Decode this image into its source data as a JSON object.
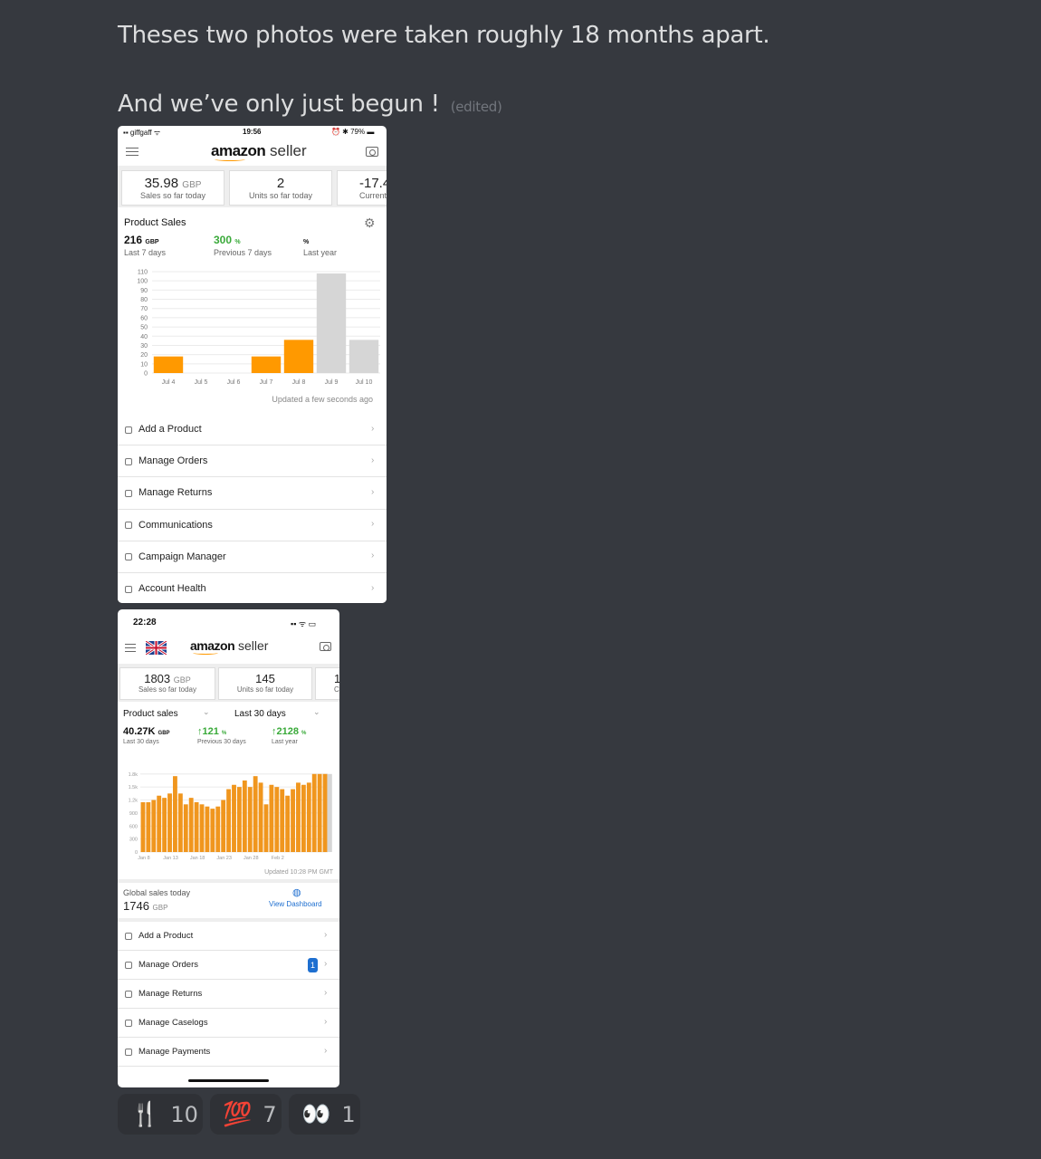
{
  "message": {
    "line1": "Theses two photos were taken roughly 18 months apart.",
    "line2": "And we’ve only just begun !",
    "edited": "(edited)"
  },
  "photo1": {
    "status": {
      "carrier": "giffgaff",
      "time": "19:56",
      "battery": "79%"
    },
    "logo": {
      "brand": "amazon",
      "product": "seller"
    },
    "stats": [
      {
        "value": "35.98",
        "unit": "GBP",
        "label": "Sales so far today"
      },
      {
        "value": "2",
        "unit": "",
        "label": "Units so far today"
      },
      {
        "value": "-17.4",
        "unit": "",
        "label": "Current"
      }
    ],
    "section_title": "Product Sales",
    "metrics": [
      {
        "value": "216",
        "unit": "GBP",
        "label": "Last 7 days"
      },
      {
        "value": "300",
        "unit": "%",
        "label": "Previous 7 days"
      },
      {
        "value": "",
        "unit": "%",
        "label": "Last year"
      }
    ],
    "updated": "Updated a few seconds ago",
    "menu": [
      {
        "label": "Add a Product",
        "icon": "tag-icon"
      },
      {
        "label": "Manage Orders",
        "icon": "box-icon"
      },
      {
        "label": "Manage Returns",
        "icon": "return-bag-icon"
      },
      {
        "label": "Communications",
        "icon": "chat-icon"
      },
      {
        "label": "Campaign Manager",
        "icon": "campaign-icon"
      },
      {
        "label": "Account Health",
        "icon": "trend-icon"
      }
    ]
  },
  "photo2": {
    "status": {
      "time": "22:28"
    },
    "logo": {
      "brand": "amazon",
      "product": "seller"
    },
    "stats": [
      {
        "value": "1803",
        "unit": "GBP",
        "label": "Sales so far today"
      },
      {
        "value": "145",
        "unit": "",
        "label": "Units so far today"
      },
      {
        "value": "1",
        "unit": "",
        "label": "C"
      }
    ],
    "section_title": "Product sales",
    "period": "Last 30 days",
    "metrics": [
      {
        "value": "40.27K",
        "unit": "GBP",
        "label": "Last 30 days"
      },
      {
        "value": "121",
        "unit": "%",
        "label": "Previous 30 days"
      },
      {
        "value": "2128",
        "unit": "%",
        "label": "Last year"
      }
    ],
    "updated": "Updated 10:28 PM GMT",
    "global": {
      "label": "Global sales today",
      "value": "1746",
      "unit": "GBP",
      "link": "View Dashboard"
    },
    "menu": [
      {
        "label": "Add a Product",
        "icon": "tag-icon",
        "badge": ""
      },
      {
        "label": "Manage Orders",
        "icon": "box-icon",
        "badge": "1"
      },
      {
        "label": "Manage Returns",
        "icon": "return-bag-icon",
        "badge": ""
      },
      {
        "label": "Manage Caselogs",
        "icon": "chat-icon",
        "badge": ""
      },
      {
        "label": "Manage Payments",
        "icon": "card-icon",
        "badge": ""
      }
    ]
  },
  "reactions": [
    {
      "emoji": "🍴",
      "name": "fork-and-knife-icon",
      "count": "10"
    },
    {
      "emoji": "💯",
      "name": "hundred-points-icon",
      "count": "7"
    },
    {
      "emoji": "👀",
      "name": "eyes-icon",
      "count": "1"
    }
  ],
  "chart_data": [
    {
      "type": "bar",
      "categories": [
        "Jul 4",
        "Jul 5",
        "Jul 6",
        "Jul 7",
        "Jul 8",
        "Jul 9",
        "Jul 10"
      ],
      "values": [
        18,
        0,
        0,
        18,
        36,
        108,
        36
      ],
      "colors": [
        "#ff9900",
        "#ff9900",
        "#ff9900",
        "#ff9900",
        "#ff9900",
        "#d6d6d6",
        "#d6d6d6"
      ],
      "yticks": [
        "0",
        "10",
        "20",
        "30",
        "40",
        "50",
        "60",
        "70",
        "80",
        "90",
        "100",
        "110"
      ],
      "ylim": [
        0,
        110
      ]
    },
    {
      "type": "bar",
      "categories": [
        "Jan 8",
        "Jan 13",
        "Jan 18",
        "Jan 23",
        "Jan 28",
        "Feb 2"
      ],
      "values": [
        1150,
        1150,
        1200,
        1300,
        1250,
        1350,
        1750,
        1350,
        1100,
        1250,
        1150,
        1100,
        1050,
        1000,
        1050,
        1200,
        1450,
        1550,
        1500,
        1650,
        1500,
        1750,
        1600,
        1100,
        1550,
        1500,
        1450,
        1300,
        1450,
        1600,
        1550,
        1600,
        1800,
        1800,
        1800
      ],
      "last_bar_partial": true,
      "colors": {
        "bar": "#f0961e",
        "current": "#d6d6d6"
      },
      "yticks": [
        "0",
        "300",
        "600",
        "900",
        "1.2k",
        "1.5k",
        "1.8k"
      ],
      "ylim": [
        0,
        1900
      ]
    }
  ]
}
